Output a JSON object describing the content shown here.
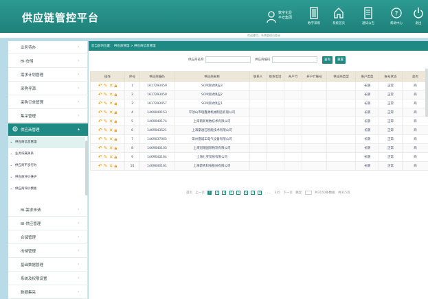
{
  "header": {
    "title": "供应链管控平台",
    "user": {
      "line1": "数字化显",
      "line2": "平安集团"
    },
    "buttons": [
      {
        "label": "数字采购",
        "icon": "door-icon"
      },
      {
        "label": "系统首页",
        "icon": "home-icon"
      },
      {
        "label": "通知公告",
        "icon": "notice-icon"
      },
      {
        "label": "帮助中心",
        "icon": "help-icon"
      },
      {
        "label": "退出",
        "icon": "power-icon"
      }
    ],
    "strip_text": "欢迎使用，系统管理员登录"
  },
  "sidebar": {
    "items_top": [
      {
        "label": "业务待办"
      },
      {
        "label": "BI-仓储"
      },
      {
        "label": "需求计划管理"
      },
      {
        "label": "采购寻源"
      },
      {
        "label": "采购订单管理"
      },
      {
        "label": "集采管理"
      }
    ],
    "active": {
      "label": "供应商管理"
    },
    "sub_items": [
      {
        "label": "供应商信息管理"
      },
      {
        "label": "业务归属关系"
      },
      {
        "label": "供应商不良行为"
      },
      {
        "label": "供应商评价维护"
      },
      {
        "label": "供应商评价模板"
      }
    ],
    "items_bottom": [
      {
        "label": "BI-需求申请"
      },
      {
        "label": "BI-供应管理"
      },
      {
        "label": "合储管理"
      },
      {
        "label": "出储管理"
      },
      {
        "label": "基础数据管理"
      },
      {
        "label": "系统及权限设置"
      },
      {
        "label": "数据集采"
      }
    ]
  },
  "main": {
    "breadcrumb": "您当前的位置：  供应商管理  >  供应商信息管理",
    "search": {
      "name_label": "供应商名称",
      "name_placeholder": "",
      "code_label": "供应商编码",
      "code_placeholder": "",
      "query_label": "查询",
      "reset_label": "重置"
    },
    "table": {
      "columns": [
        "操作",
        "序号",
        "供应商编码",
        "供应商名称",
        "联系人",
        "联系电话",
        "开户行",
        "开户行账号",
        "供应商类型",
        "账户类型",
        "账号状态",
        "是否"
      ],
      "rows": [
        {
          "idx": "1",
          "code": "1617293459",
          "name": "SCM测试供应3",
          "acct": "长期",
          "status": "正常",
          "flag": "商"
        },
        {
          "idx": "2",
          "code": "1617293458",
          "name": "SCM测试供应2",
          "acct": "长期",
          "status": "正常",
          "flag": "商"
        },
        {
          "idx": "3",
          "code": "1617293457",
          "name": "SCM测试供应1",
          "acct": "长期",
          "status": "正常",
          "flag": "商"
        },
        {
          "idx": "4",
          "code": "1469040153",
          "name": "平顶山市瑞鑫源机械制造有限公司",
          "acct": "长期",
          "status": "正常",
          "flag": "商"
        },
        {
          "idx": "5",
          "code": "1469040174",
          "name": "上海南新泵数技术有限公司",
          "acct": "长期",
          "status": "正常",
          "flag": "商"
        },
        {
          "idx": "6",
          "code": "1469043521",
          "name": "上海豪通石智能技术有限公司",
          "acct": "长期",
          "status": "正常",
          "flag": "商"
        },
        {
          "idx": "7",
          "code": "1469037065",
          "name": "常州嘉诚工电气设备有限公司",
          "acct": "长期",
          "status": "正常",
          "flag": "商"
        },
        {
          "idx": "8",
          "code": "1469040105",
          "name": "上海冠翔国际物流有限公司",
          "acct": "长期",
          "status": "正常",
          "flag": "商"
        },
        {
          "idx": "9",
          "code": "1469040164",
          "name": "上海七罗贸易有限公司",
          "acct": "长期",
          "status": "正常",
          "flag": "商"
        },
        {
          "idx": "10",
          "code": "1469040161",
          "name": "上海碧秀科技股份有限公司",
          "acct": "长期",
          "status": "正常",
          "flag": "商"
        }
      ]
    },
    "pager": {
      "first": "首页",
      "prev": "上一页",
      "pages": [
        "1",
        "2",
        "3",
        "4",
        "5",
        "6",
        "7",
        "8"
      ],
      "ellipsis": "……",
      "last_page": "315",
      "next": "下一页",
      "go": "跳至",
      "total": "共3150条数据",
      "per": "共315页"
    }
  },
  "colors": {
    "brand": "#1f8a83",
    "op_icon": "#f0a11f",
    "header_row": "#ece7d8"
  }
}
